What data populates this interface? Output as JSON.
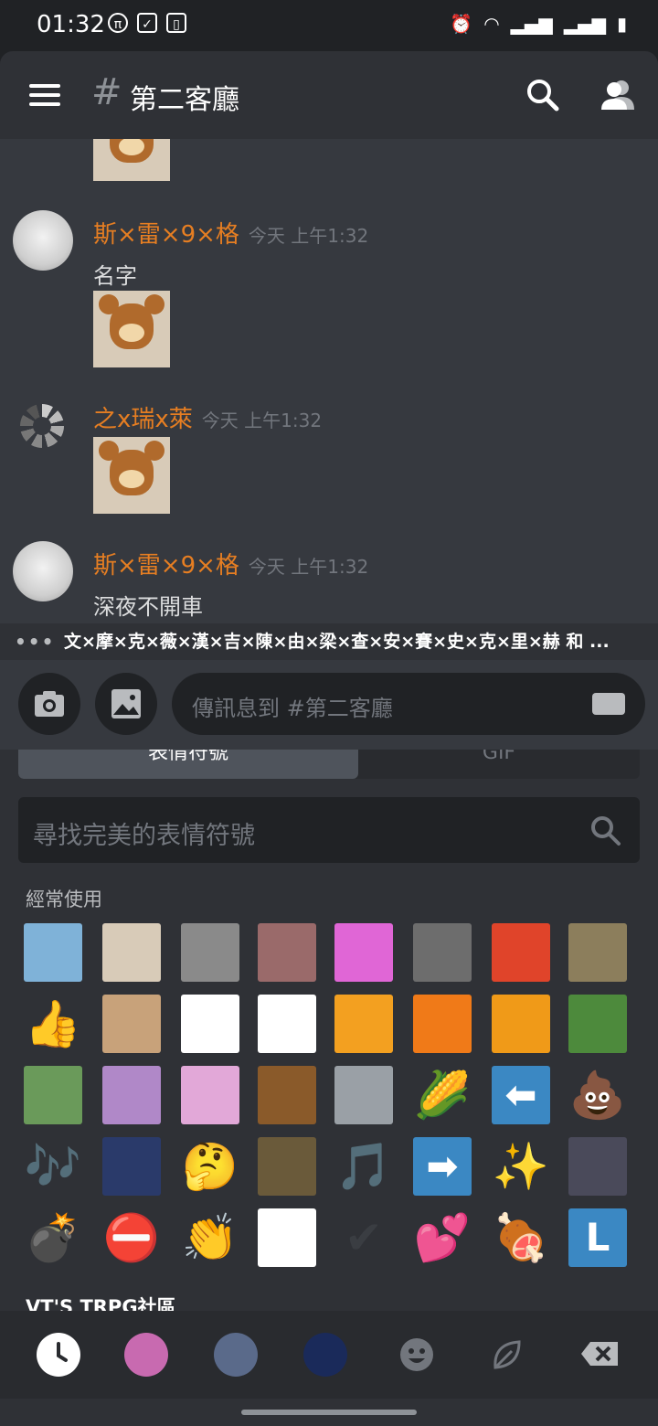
{
  "status_bar": {
    "time": "01:32"
  },
  "header": {
    "hash": "#",
    "channel_name": "第二客廳"
  },
  "messages": [
    {
      "username": "斯×雷×9×格",
      "timestamp": "今天 上午1:32",
      "text": "名字"
    },
    {
      "username": "之x瑞x萊",
      "timestamp": "今天 上午1:32"
    },
    {
      "username": "斯×雷×9×格",
      "timestamp": "今天 上午1:32",
      "text": "深夜不開車"
    }
  ],
  "typing_indicator": {
    "dots": "•••",
    "text": "文×摩×克×薇×漢×吉×陳×由×梁×查×安×賽×史×克×里×赫 和 ..."
  },
  "composer": {
    "placeholder": "傳訊息到 #第二客廳"
  },
  "picker": {
    "tabs": [
      "表情符號",
      "GIF"
    ],
    "search_placeholder": "尋找完美的表情符號",
    "section_frequent": "經常使用",
    "section_server": "VT'S TRPG社區",
    "emojis": [
      {
        "name": "smiling-man-emoji",
        "glyph": "",
        "bg": "#7fb2d8"
      },
      {
        "name": "jerry-mouse-emoji",
        "glyph": "",
        "bg": "#d8cbb8"
      },
      {
        "name": "screaming-cat-emoji",
        "glyph": "",
        "bg": "#8a8a8a"
      },
      {
        "name": "anime-girl-wall-emoji",
        "glyph": "",
        "bg": "#9a6a6a"
      },
      {
        "name": "pink-cat-rainbow-emoji",
        "glyph": "",
        "bg": "#e066d6"
      },
      {
        "name": "screaming-face-emoji",
        "glyph": "",
        "bg": "#6d6d6d"
      },
      {
        "name": "laser-eyes-emoji",
        "glyph": "",
        "bg": "#e0442a"
      },
      {
        "name": "seal-emoji",
        "glyph": "",
        "bg": "#8c7e5c"
      },
      {
        "name": "thumbs-up-emoji",
        "glyph": "👍",
        "bg": "transparent"
      },
      {
        "name": "hamster-emoji",
        "glyph": "",
        "bg": "#c8a27a"
      },
      {
        "name": "rabbit-dance-emoji",
        "glyph": "",
        "bg": "#ffffff"
      },
      {
        "name": "rabbit-heart-emoji",
        "glyph": "",
        "bg": "#ffffff"
      },
      {
        "name": "anime-explosion-emoji",
        "glyph": "",
        "bg": "#f3a020"
      },
      {
        "name": "drake-no-emoji",
        "glyph": "",
        "bg": "#f07a18"
      },
      {
        "name": "drake-yes-emoji",
        "glyph": "",
        "bg": "#f09a18"
      },
      {
        "name": "parrot-emoji",
        "glyph": "",
        "bg": "#4d8a3c"
      },
      {
        "name": "anime-girl-green-hair-emoji",
        "glyph": "",
        "bg": "#6a9a5a"
      },
      {
        "name": "anime-girl-pink-hair-emoji",
        "glyph": "",
        "bg": "#b088c8"
      },
      {
        "name": "anime-girl-shocked-emoji",
        "glyph": "",
        "bg": "#e2a8d8"
      },
      {
        "name": "woody-face-emoji",
        "glyph": "",
        "bg": "#8a5a2a"
      },
      {
        "name": "tom-cat-shocked-emoji",
        "glyph": "",
        "bg": "#9aa0a6"
      },
      {
        "name": "corn-emoji",
        "glyph": "🌽",
        "bg": "transparent"
      },
      {
        "name": "arrow-left-emoji",
        "glyph": "⬅",
        "bg": "#3b88c3"
      },
      {
        "name": "poop-emoji",
        "glyph": "💩",
        "bg": "transparent"
      },
      {
        "name": "musical-notes-emoji",
        "glyph": "🎶",
        "bg": "transparent"
      },
      {
        "name": "space-cat-emoji",
        "glyph": "",
        "bg": "#2a3a6a"
      },
      {
        "name": "thinking-face-emoji",
        "glyph": "🤔",
        "bg": "transparent"
      },
      {
        "name": "blurry-dog-emoji",
        "glyph": "",
        "bg": "#6a5a3a"
      },
      {
        "name": "musical-note-emoji",
        "glyph": "🎵",
        "bg": "transparent"
      },
      {
        "name": "arrow-right-emoji",
        "glyph": "➡",
        "bg": "#3b88c3"
      },
      {
        "name": "sparkles-emoji",
        "glyph": "✨",
        "bg": "transparent"
      },
      {
        "name": "anime-glasses-man-emoji",
        "glyph": "",
        "bg": "#4a4a5a"
      },
      {
        "name": "bomb-emoji",
        "glyph": "💣",
        "bg": "transparent"
      },
      {
        "name": "no-entry-emoji",
        "glyph": "⛔",
        "bg": "transparent"
      },
      {
        "name": "clapping-hands-emoji",
        "glyph": "👏",
        "bg": "transparent"
      },
      {
        "name": "penguin-gun-emoji",
        "glyph": "",
        "bg": "#ffffff"
      },
      {
        "name": "check-mark-emoji",
        "glyph": "✔",
        "bg": "transparent"
      },
      {
        "name": "two-hearts-emoji",
        "glyph": "💕",
        "bg": "transparent"
      },
      {
        "name": "meat-on-bone-emoji",
        "glyph": "🍖",
        "bg": "transparent"
      },
      {
        "name": "letter-l-emoji",
        "glyph": "L",
        "bg": "#3b88c3"
      }
    ]
  }
}
